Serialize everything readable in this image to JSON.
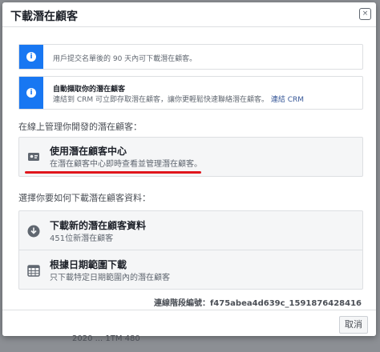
{
  "background": {
    "bottom_fragment": "2020 ... 1TM 480"
  },
  "dialog": {
    "title": "下載潛在顧客",
    "close_glyph": "×"
  },
  "notices": [
    {
      "icon": "info-icon",
      "text": "用戶提交名單後的 90 天內可下載潛在顧客。"
    },
    {
      "icon": "info-icon",
      "title": "自動擷取你的潛在顧客",
      "text": "連結到 CRM 可立即存取潛在顧客，讓你更輕鬆快速聯絡潛在顧客。",
      "link": "連結 CRM"
    }
  ],
  "manage_label": "在線上管理你開發的潛在顧客：",
  "manage_option": {
    "title": "使用潛在顧客中心",
    "subtitle": "在潛在顧客中心即時查看並管理潛在顧客。",
    "icon": "contact-card-icon"
  },
  "download_label": "選擇你要如何下載潛在顧客資料：",
  "download_options": [
    {
      "title": "下載新的潛在顧客資料",
      "subtitle": "451位新潛在顧客",
      "icon": "download-icon"
    },
    {
      "title": "根據日期範圍下載",
      "subtitle": "只下載特定日期範圍內的潛在顧客",
      "icon": "calendar-icon"
    }
  ],
  "connection_id": "連線階段編號：f475abea4d639c_1591876428416",
  "cancel_label": "取消",
  "colors": {
    "accent": "#1877f2",
    "annotation": "#e0161d"
  }
}
